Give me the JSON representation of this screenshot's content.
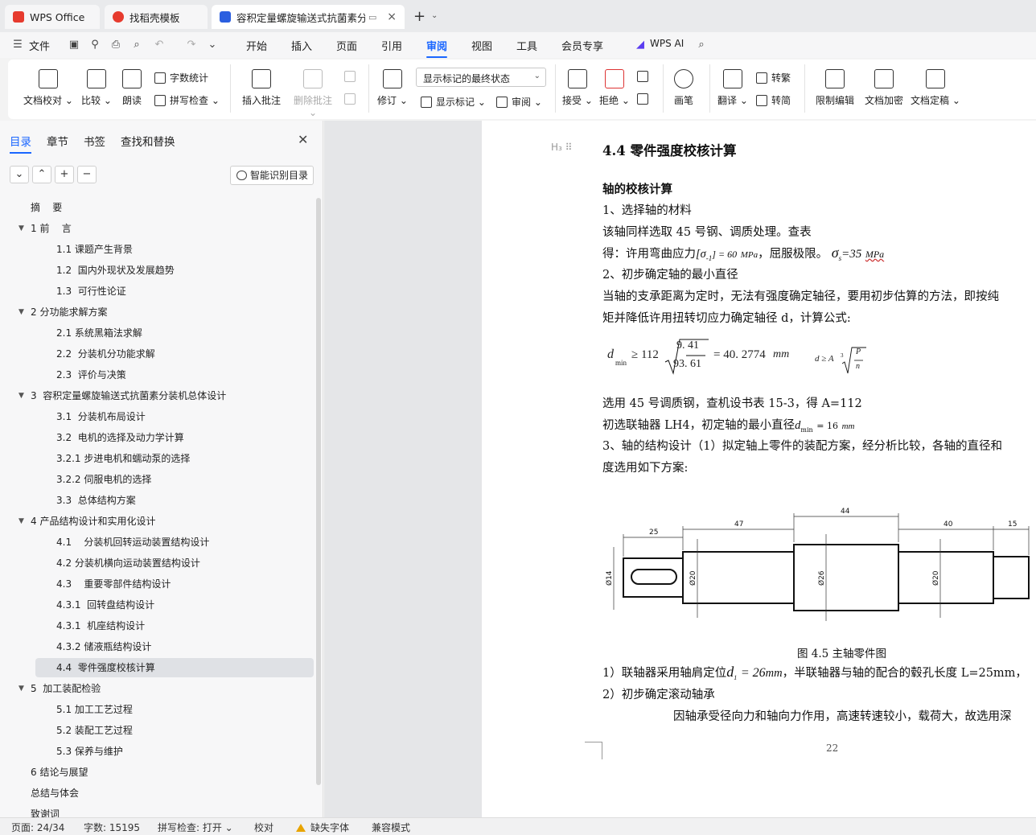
{
  "tabs": [
    {
      "label": "WPS Office",
      "icon": "wps-logo-icon",
      "color": "#e63b2e"
    },
    {
      "label": "找稻壳模板",
      "icon": "docer-icon",
      "color": "#e63b2e"
    },
    {
      "label": "容积定量螺旋输送式抗菌素分",
      "icon": "writer-doc-icon",
      "color": "#2b5fe0",
      "close": "×"
    }
  ],
  "newtab": "+",
  "menu": {
    "file": "文件",
    "items": [
      "开始",
      "插入",
      "页面",
      "引用",
      "审阅",
      "视图",
      "工具",
      "会员专享"
    ],
    "active": "审阅",
    "ai": "WPS AI"
  },
  "ribbon": {
    "proofread": "文档校对",
    "compare": "比较",
    "read_aloud": "朗读",
    "word_count": "字数统计",
    "spell_check": "拼写检查",
    "insert_comment": "插入批注",
    "delete_comment": "删除批注",
    "track": "修订",
    "markup_state": "显示标记的最终状态",
    "show_markup": "显示标记",
    "review": "审阅",
    "accept": "接受",
    "reject": "拒绝",
    "ink": "画笔",
    "translate": "翻译",
    "to_traditional": "转繁",
    "to_simplified": "转简",
    "restrict": "限制编辑",
    "encrypt": "文档加密",
    "finalize": "文档定稿"
  },
  "nav": {
    "tabs": [
      "目录",
      "章节",
      "书签",
      "查找和替换"
    ],
    "smart": "智能识别目录",
    "toc": [
      {
        "label": "摘    要",
        "level": 0
      },
      {
        "label": "1 前    言",
        "level": 0,
        "caret": true
      },
      {
        "label": "1.1 课题产生背景",
        "level": 1
      },
      {
        "label": "1.2  国内外现状及发展趋势",
        "level": 1
      },
      {
        "label": "1.3  可行性论证",
        "level": 1
      },
      {
        "label": "2 分功能求解方案",
        "level": 0,
        "caret": true
      },
      {
        "label": "2.1 系统黑箱法求解",
        "level": 1
      },
      {
        "label": "2.2  分装机分功能求解",
        "level": 1
      },
      {
        "label": "2.3  评价与决策",
        "level": 1
      },
      {
        "label": "3  容积定量螺旋输送式抗菌素分装机总体设计",
        "level": 0,
        "caret": true
      },
      {
        "label": "3.1  分装机布局设计",
        "level": 1
      },
      {
        "label": "3.2  电机的选择及动力学计算",
        "level": 1
      },
      {
        "label": "3.2.1 步进电机和蠕动泵的选择",
        "level": 1
      },
      {
        "label": "3.2.2 伺服电机的选择",
        "level": 1
      },
      {
        "label": "3.3  总体结构方案",
        "level": 1
      },
      {
        "label": "4 产品结构设计和实用化设计",
        "level": 0,
        "caret": true
      },
      {
        "label": "4.1    分装机回转运动装置结构设计",
        "level": 1
      },
      {
        "label": "4.2 分装机横向运动装置结构设计",
        "level": 1
      },
      {
        "label": "4.3    重要零部件结构设计",
        "level": 1
      },
      {
        "label": "4.3.1  回转盘结构设计",
        "level": 1
      },
      {
        "label": "4.3.1  机座结构设计",
        "level": 1
      },
      {
        "label": "4.3.2 储液瓶结构设计",
        "level": 1
      },
      {
        "label": "4.4  零件强度校核计算",
        "level": 1,
        "selected": true
      },
      {
        "label": "5  加工装配检验",
        "level": 0,
        "caret": true
      },
      {
        "label": "5.1 加工工艺过程",
        "level": 1
      },
      {
        "label": "5.2 装配工艺过程",
        "level": 1
      },
      {
        "label": "5.3 保养与维护",
        "level": 1
      },
      {
        "label": "6 结论与展望",
        "level": 0
      },
      {
        "label": "总结与体会",
        "level": 0
      },
      {
        "label": "致谢词",
        "level": 0
      }
    ]
  },
  "doc": {
    "heading": "4.4  零件强度校核计算",
    "sub": "轴的校核计算",
    "l1": "1、选择轴的材料",
    "l2": "该轴同样选取 45 号钢、调质处理。查表",
    "l3a": "得：许用弯曲应力",
    "l3b": "[σ",
    "l3c": "-1",
    "l3d": "] = 60",
    "l3unit": "MPa",
    "l3e": "，屈服极限。",
    "l3f": "σ",
    "l3g": "s",
    "l3h": "=35",
    "l3i": "MPa",
    "l4": "2、初步确定轴的最小直径",
    "l5": "当轴的支承距离为定时，无法有强度确定轴径，要用初步估算的方法，即按纯",
    "l6": "矩并降低许用扭转切应力确定轴径 d，计算公式:",
    "f_d": "d",
    "f_min": "min",
    "f_ge": "≥ 112",
    "f_num": "9. 41",
    "f_den": "93. 61",
    "f_eq": "= 40. 2774",
    "f_mm": "mm",
    "f2_d": "d ≥ A",
    "f2_p": "P",
    "f2_n": "n",
    "f2_idx": "3",
    "l7": "选用 45 号调质钢，查机设书表 15-3，得 A=112",
    "l8a": "初选联轴器 LH4，初定轴的最小直径",
    "l8b": "d",
    "l8c": "min",
    "l8d": "= 16",
    "l8e": "mm",
    "l9": "3、轴的结构设计（1）拟定轴上零件的装配方案，经分析比较，各轴的直径和",
    "l10": "度选用如下方案:",
    "caption": "图 4.5 主轴零件图",
    "l11a": "1）联轴器采用轴肩定位",
    "l11b": "d",
    "l11c": "1",
    "l11d": "= 26",
    "l11e": "mm",
    "l11f": "，半联轴器与轴的配合的毂孔长度 L=25mm，",
    "l12": "2）初步确定滚动轴承",
    "l13": "因轴承受径向力和轴向力作用，高速转速较小，载荷大，故选用深",
    "page_num": "22",
    "drawing": {
      "dims": [
        "25",
        "47",
        "44",
        "40",
        "15"
      ],
      "dias": [
        "Ø14",
        "Ø20",
        "Ø26",
        "Ø20"
      ]
    }
  },
  "status": {
    "page": "页面: 24/34",
    "words": "字数: 15195",
    "spell": "拼写检查: 打开",
    "proof": "校对",
    "missing_font": "缺失字体",
    "compat": "兼容模式"
  }
}
